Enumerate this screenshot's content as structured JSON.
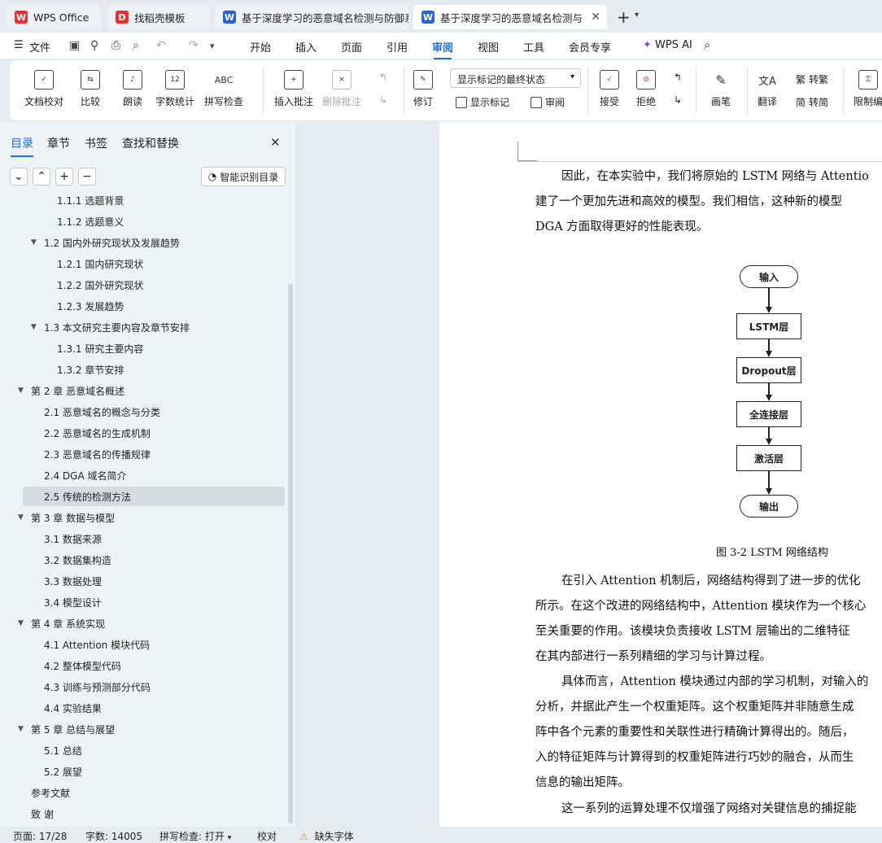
{
  "tabs": [
    {
      "label": "WPS Office",
      "icon": "wps-logo-icon"
    },
    {
      "label": "找稻壳模板",
      "icon": "docer-icon"
    },
    {
      "label": "基于深度学习的恶意域名检测与防御系",
      "icon": "word-doc-icon"
    },
    {
      "label": "基于深度学习的恶意域名检测与",
      "icon": "word-doc-icon"
    }
  ],
  "menu": {
    "file": "文件",
    "items": [
      "开始",
      "插入",
      "页面",
      "引用",
      "审阅",
      "视图",
      "工具",
      "会员专享"
    ],
    "active": "审阅",
    "wps_ai": "WPS AI"
  },
  "ribbon": {
    "doc_check": "文档校对",
    "compare": "比较",
    "read_aloud": "朗读",
    "word_count": "字数统计",
    "spell_check": "拼写检查",
    "insert_comment": "插入批注",
    "delete_comment": "删除批注",
    "track_changes": "修订",
    "markup_state": "显示标记的最终状态",
    "show_markup": "显示标记",
    "review": "审阅",
    "accept": "接受",
    "reject": "拒绝",
    "ink": "画笔",
    "translate": "翻译",
    "to_traditional": "转繁",
    "to_simplified": "转简",
    "restrict": "限制编",
    "icon_word_count_text": "12",
    "icon_spell_text": "ABC"
  },
  "sidebar": {
    "tabs": [
      "目录",
      "章节",
      "书签",
      "查找和替换"
    ],
    "active_tab": "目录",
    "smart_button": "智能识别目录",
    "toc": [
      {
        "label": "1.1.1  选题背景",
        "level": 3,
        "toggle": ""
      },
      {
        "label": "1.1.2  选题意义",
        "level": 3,
        "toggle": ""
      },
      {
        "label": "1.2  国内外研究现状及发展趋势",
        "level": 2,
        "toggle": "▼"
      },
      {
        "label": "1.2.1  国内研究现状",
        "level": 3,
        "toggle": ""
      },
      {
        "label": "1.2.2  国外研究现状",
        "level": 3,
        "toggle": ""
      },
      {
        "label": "1.2.3  发展趋势",
        "level": 3,
        "toggle": ""
      },
      {
        "label": "1.3  本文研究主要内容及章节安排",
        "level": 2,
        "toggle": "▼"
      },
      {
        "label": "1.3.1  研究主要内容",
        "level": 3,
        "toggle": ""
      },
      {
        "label": "1.3.2  章节安排",
        "level": 3,
        "toggle": ""
      },
      {
        "label": "第 2 章  恶意域名概述",
        "level": 1,
        "toggle": "▼"
      },
      {
        "label": "2.1  恶意域名的概念与分类",
        "level": 2,
        "toggle": ""
      },
      {
        "label": "2.2  恶意域名的生成机制",
        "level": 2,
        "toggle": ""
      },
      {
        "label": "2.3  恶意域名的传播规律",
        "level": 2,
        "toggle": ""
      },
      {
        "label": "2.4 DGA 域名简介",
        "level": 2,
        "toggle": ""
      },
      {
        "label": "2.5  传统的检测方法",
        "level": 2,
        "toggle": "",
        "selected": true
      },
      {
        "label": "第 3 章  数据与模型",
        "level": 1,
        "toggle": "▼"
      },
      {
        "label": "3.1  数据来源",
        "level": 2,
        "toggle": ""
      },
      {
        "label": "3.2  数据集构造",
        "level": 2,
        "toggle": ""
      },
      {
        "label": "3.3  数据处理",
        "level": 2,
        "toggle": ""
      },
      {
        "label": "3.4  模型设计",
        "level": 2,
        "toggle": ""
      },
      {
        "label": "第 4 章  系统实现",
        "level": 1,
        "toggle": "▼"
      },
      {
        "label": "4.1 Attention 模块代码",
        "level": 2,
        "toggle": ""
      },
      {
        "label": "4.2  整体模型代码",
        "level": 2,
        "toggle": ""
      },
      {
        "label": "4.3  训练与预测部分代码",
        "level": 2,
        "toggle": ""
      },
      {
        "label": "4.4  实验结果",
        "level": 2,
        "toggle": ""
      },
      {
        "label": "第 5 章  总结与展望",
        "level": 1,
        "toggle": "▼"
      },
      {
        "label": "5.1  总结",
        "level": 2,
        "toggle": ""
      },
      {
        "label": "5.2  展望",
        "level": 2,
        "toggle": ""
      },
      {
        "label": "参考文献",
        "level": 1,
        "toggle": ""
      },
      {
        "label": "致    谢",
        "level": 1,
        "toggle": ""
      }
    ]
  },
  "document": {
    "para1": [
      "因此，在本实验中，我们将原始的 LSTM 网络与 Attentio",
      "建了一个更加先进和高效的模型。我们相信，这种新的模型",
      "DGA 方面取得更好的性能表现。"
    ],
    "flowchart": [
      "输入",
      "LSTM层",
      "Dropout层",
      "全连接层",
      "激活层",
      "输出"
    ],
    "caption": "图 3-2 LSTM 网络结构",
    "para2": [
      "在引入 Attention 机制后，网络结构得到了进一步的优化",
      "所示。在这个改进的网络结构中，Attention 模块作为一个核心",
      "至关重要的作用。该模块负责接收 LSTM 层输出的二维特征",
      "在其内部进行一系列精细的学习与计算过程。",
      "具体而言，Attention 模块通过内部的学习机制，对输入的",
      "分析，并据此产生一个权重矩阵。这个权重矩阵并非随意生成",
      "阵中各个元素的重要性和关联性进行精确计算得出的。随后，",
      "入的特征矩阵与计算得到的权重矩阵进行巧妙的融合，从而生",
      "信息的输出矩阵。",
      "这一系列的运算处理不仅增强了网络对关键信息的捕捉能"
    ]
  },
  "status": {
    "page": "页面: 17/28",
    "words": "字数: 14005",
    "spell": "拼写检查: 打开",
    "proof": "校对",
    "missing_font": "缺失字体"
  },
  "colors": {
    "accent": "#1f6fe0",
    "wps_red": "#e8312f",
    "word_blue": "#2b5fd9"
  }
}
